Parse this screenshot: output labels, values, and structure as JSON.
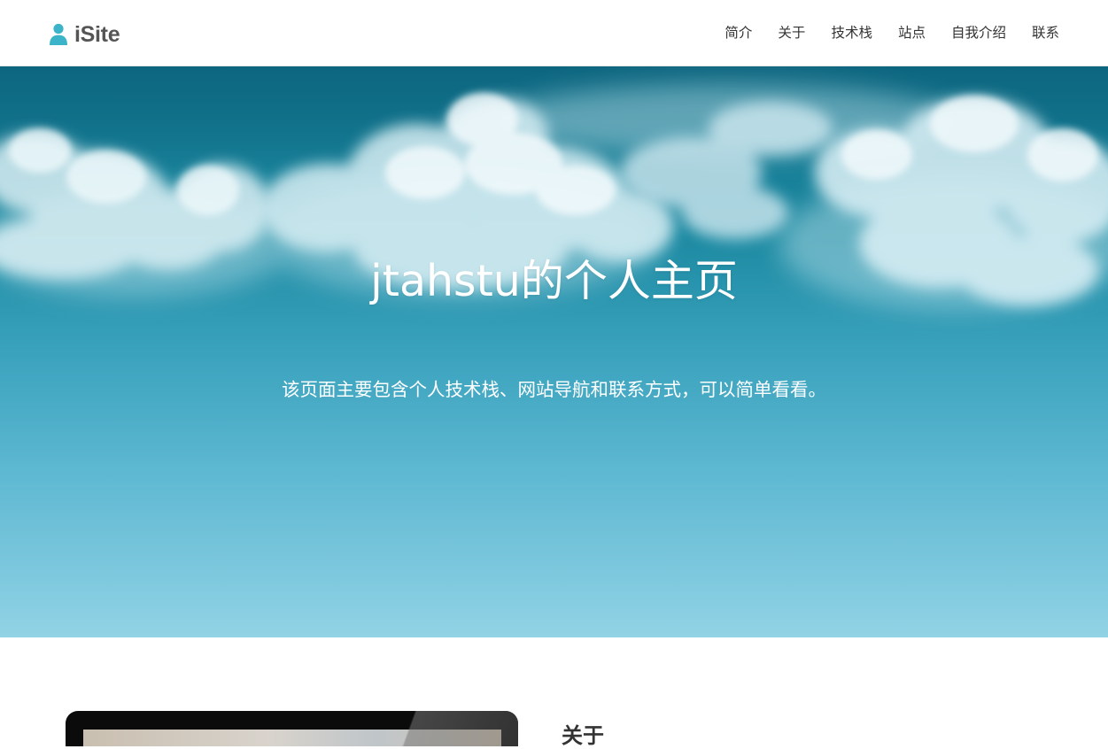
{
  "brand": {
    "name": "iSite",
    "icon": "user-icon",
    "icon_color": "#3bb4c9"
  },
  "nav": {
    "items": [
      {
        "label": "简介"
      },
      {
        "label": "关于"
      },
      {
        "label": "技术栈"
      },
      {
        "label": "站点"
      },
      {
        "label": "自我介绍"
      },
      {
        "label": "联系"
      }
    ]
  },
  "hero": {
    "title": "jtahstu的个人主页",
    "subtitle": "该页面主要包含个人技术栈、网站导航和联系方式，可以简单看看。",
    "background": "sky-with-clouds",
    "gradient_top": "#0f6f88",
    "gradient_bottom": "#92d3e5"
  },
  "about": {
    "heading": "关于",
    "image": "laptop-image"
  }
}
